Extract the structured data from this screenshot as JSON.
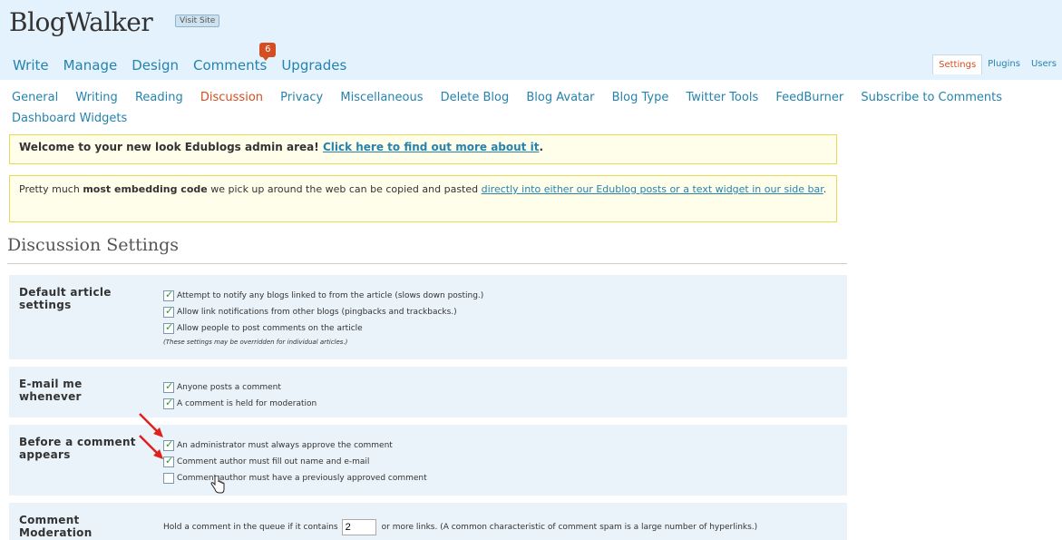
{
  "header": {
    "blog_title": "BlogWalker",
    "visit_site_label": "Visit Site"
  },
  "main_nav": {
    "items": [
      {
        "label": "Write"
      },
      {
        "label": "Manage"
      },
      {
        "label": "Design"
      },
      {
        "label": "Comments",
        "badge": "6"
      },
      {
        "label": "Upgrades"
      }
    ]
  },
  "side_nav": {
    "items": [
      {
        "label": "Settings",
        "current": true
      },
      {
        "label": "Plugins"
      },
      {
        "label": "Users"
      }
    ]
  },
  "sub_nav": {
    "items": [
      {
        "label": "General"
      },
      {
        "label": "Writing"
      },
      {
        "label": "Reading"
      },
      {
        "label": "Discussion",
        "current": true
      },
      {
        "label": "Privacy"
      },
      {
        "label": "Miscellaneous"
      },
      {
        "label": "Delete Blog"
      },
      {
        "label": "Blog Avatar"
      },
      {
        "label": "Blog Type"
      },
      {
        "label": "Twitter Tools"
      },
      {
        "label": "FeedBurner"
      },
      {
        "label": "Subscribe to Comments"
      },
      {
        "label": "Dashboard Widgets"
      }
    ]
  },
  "notices": {
    "welcome_text": "Welcome to your new look Edublogs admin area!",
    "welcome_link": "Click here to find out more about it",
    "welcome_end": ".",
    "embed_prefix": "Pretty much ",
    "embed_bold": "most embedding code",
    "embed_middle": " we pick up around the web can be copied and pasted ",
    "embed_link": "directly into either our Edublog posts or a text widget in our side bar",
    "embed_end": "."
  },
  "page_title": "Discussion Settings",
  "sections": {
    "default_article": {
      "heading": "Default article settings",
      "options": [
        {
          "label": "Attempt to notify any blogs linked to from the article (slows down posting.)",
          "checked": true
        },
        {
          "label": "Allow link notifications from other blogs (pingbacks and trackbacks.)",
          "checked": true
        },
        {
          "label": "Allow people to post comments on the article",
          "checked": true
        }
      ],
      "note": "(These settings may be overridden for individual articles.)"
    },
    "email": {
      "heading": "E-mail me whenever",
      "options": [
        {
          "label": "Anyone posts a comment",
          "checked": true
        },
        {
          "label": "A comment is held for moderation",
          "checked": true
        }
      ]
    },
    "before": {
      "heading": "Before a comment appears",
      "options": [
        {
          "label": "An administrator must always approve the comment",
          "checked": true
        },
        {
          "label": "Comment author must fill out name and e-mail",
          "checked": true
        },
        {
          "label": "Comment author must have a previously approved comment",
          "checked": false
        }
      ]
    },
    "moderation": {
      "heading": "Comment Moderation",
      "prefix": "Hold a comment in the queue if it contains",
      "value": "2",
      "suffix": "or more links. (A common characteristic of comment spam is a large number of hyperlinks.)"
    }
  },
  "colors": {
    "header_bg": "#e4f2fd",
    "link": "#2583ad",
    "current": "#d54e21",
    "arrow": "#e0201a"
  }
}
